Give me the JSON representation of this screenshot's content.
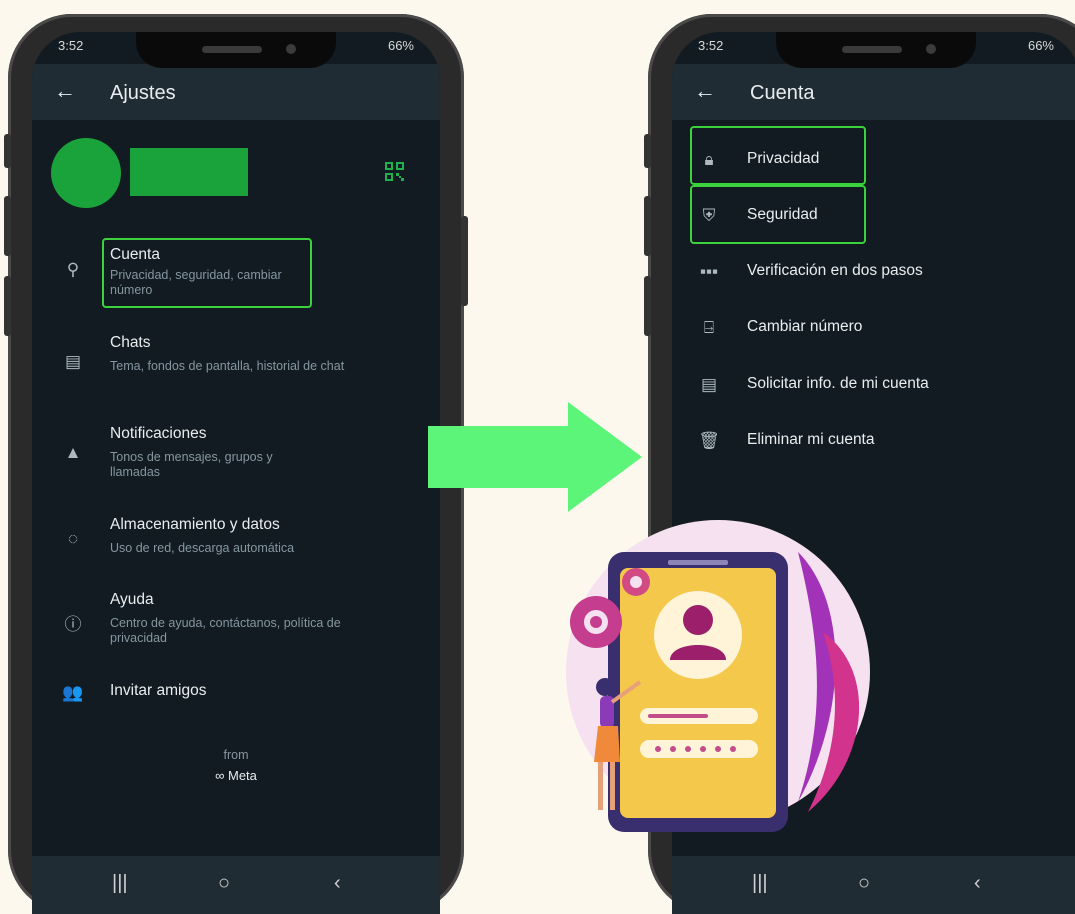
{
  "left_phone": {
    "status_time": "3:52",
    "status_right": "66%",
    "back_glyph": "←",
    "title": "Ajustes",
    "qr_icon": "qr-code-icon",
    "menu": [
      {
        "icon": "key-icon",
        "label": "Cuenta",
        "sub": "Privacidad, seguridad, cambiar número"
      },
      {
        "icon": "chat-icon",
        "label": "Chats",
        "sub": "Tema, fondos de pantalla, historial de chat"
      },
      {
        "icon": "bell-icon",
        "label": "Notificaciones",
        "sub": "Tonos de mensajes, grupos y llamadas"
      },
      {
        "icon": "storage-icon",
        "label": "Almacenamiento y datos",
        "sub": "Uso de red, descarga automática"
      },
      {
        "icon": "help-icon",
        "label": "Ayuda",
        "sub": "Centro de ayuda, contáctanos, política de privacidad"
      },
      {
        "icon": "people-icon",
        "label": "Invitar amigos"
      }
    ],
    "footer_from": "from",
    "footer_brand": "∞ Meta"
  },
  "right_phone": {
    "status_time": "3:52",
    "status_right": "66%",
    "back_glyph": "←",
    "title": "Cuenta",
    "menu": [
      {
        "icon": "lock-icon",
        "label": "Privacidad"
      },
      {
        "icon": "shield-icon",
        "label": "Seguridad"
      },
      {
        "icon": "dots-icon",
        "label": "Verificación en dos pasos"
      },
      {
        "icon": "sim-change-icon",
        "label": "Cambiar número"
      },
      {
        "icon": "document-icon",
        "label": "Solicitar info. de mi cuenta"
      },
      {
        "icon": "trash-icon",
        "label": "Eliminar mi cuenta"
      }
    ]
  },
  "nav": {
    "recent": "|||",
    "home": "○",
    "back": "‹"
  },
  "colors": {
    "highlight": "#3bd23b",
    "arrow": "#5cf57a",
    "avatar": "#1aa33a",
    "background": "#fdf8ee"
  }
}
